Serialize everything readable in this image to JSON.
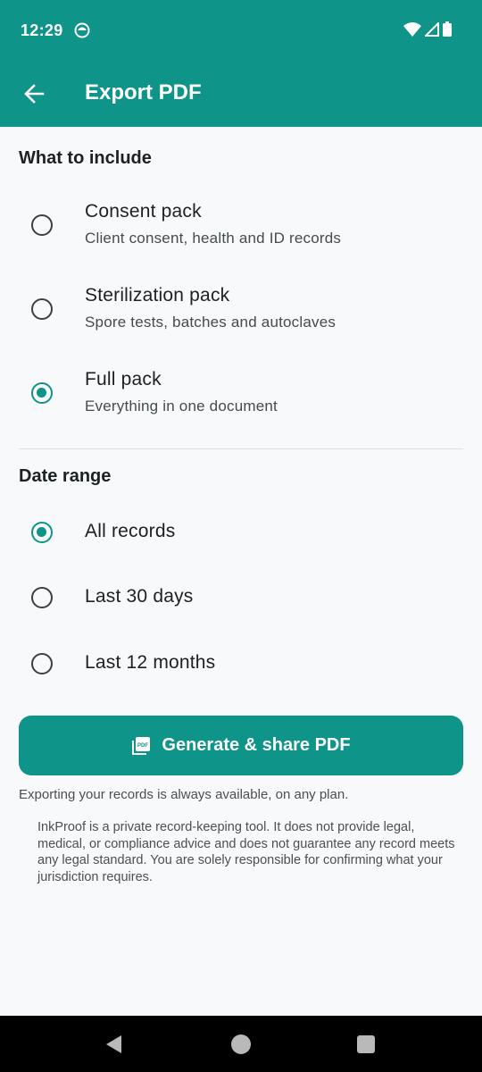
{
  "status_bar": {
    "time": "12:29"
  },
  "app_bar": {
    "title": "Export PDF"
  },
  "include_section": {
    "title": "What to include",
    "options": [
      {
        "title": "Consent pack",
        "subtitle": "Client consent, health and ID records",
        "selected": false
      },
      {
        "title": "Sterilization pack",
        "subtitle": "Spore tests, batches and autoclaves",
        "selected": false
      },
      {
        "title": "Full pack",
        "subtitle": "Everything in one document",
        "selected": true
      }
    ]
  },
  "date_section": {
    "title": "Date range",
    "options": [
      {
        "title": "All records",
        "selected": true
      },
      {
        "title": "Last 30 days",
        "selected": false
      },
      {
        "title": "Last 12 months",
        "selected": false
      }
    ]
  },
  "actions": {
    "generate_label": "Generate & share PDF",
    "generate_icon": "pdf-icon"
  },
  "note": "Exporting your records is always available, on any plan.",
  "disclaimer": "InkProof is a private record-keeping tool. It does not provide legal, medical, or compliance advice and does not guarantee any record meets any legal standard. You are solely responsible for confirming what your jurisdiction requires.",
  "colors": {
    "accent": "#0e9488",
    "background": "#f7f9fa",
    "nav_bar": "#000000"
  }
}
